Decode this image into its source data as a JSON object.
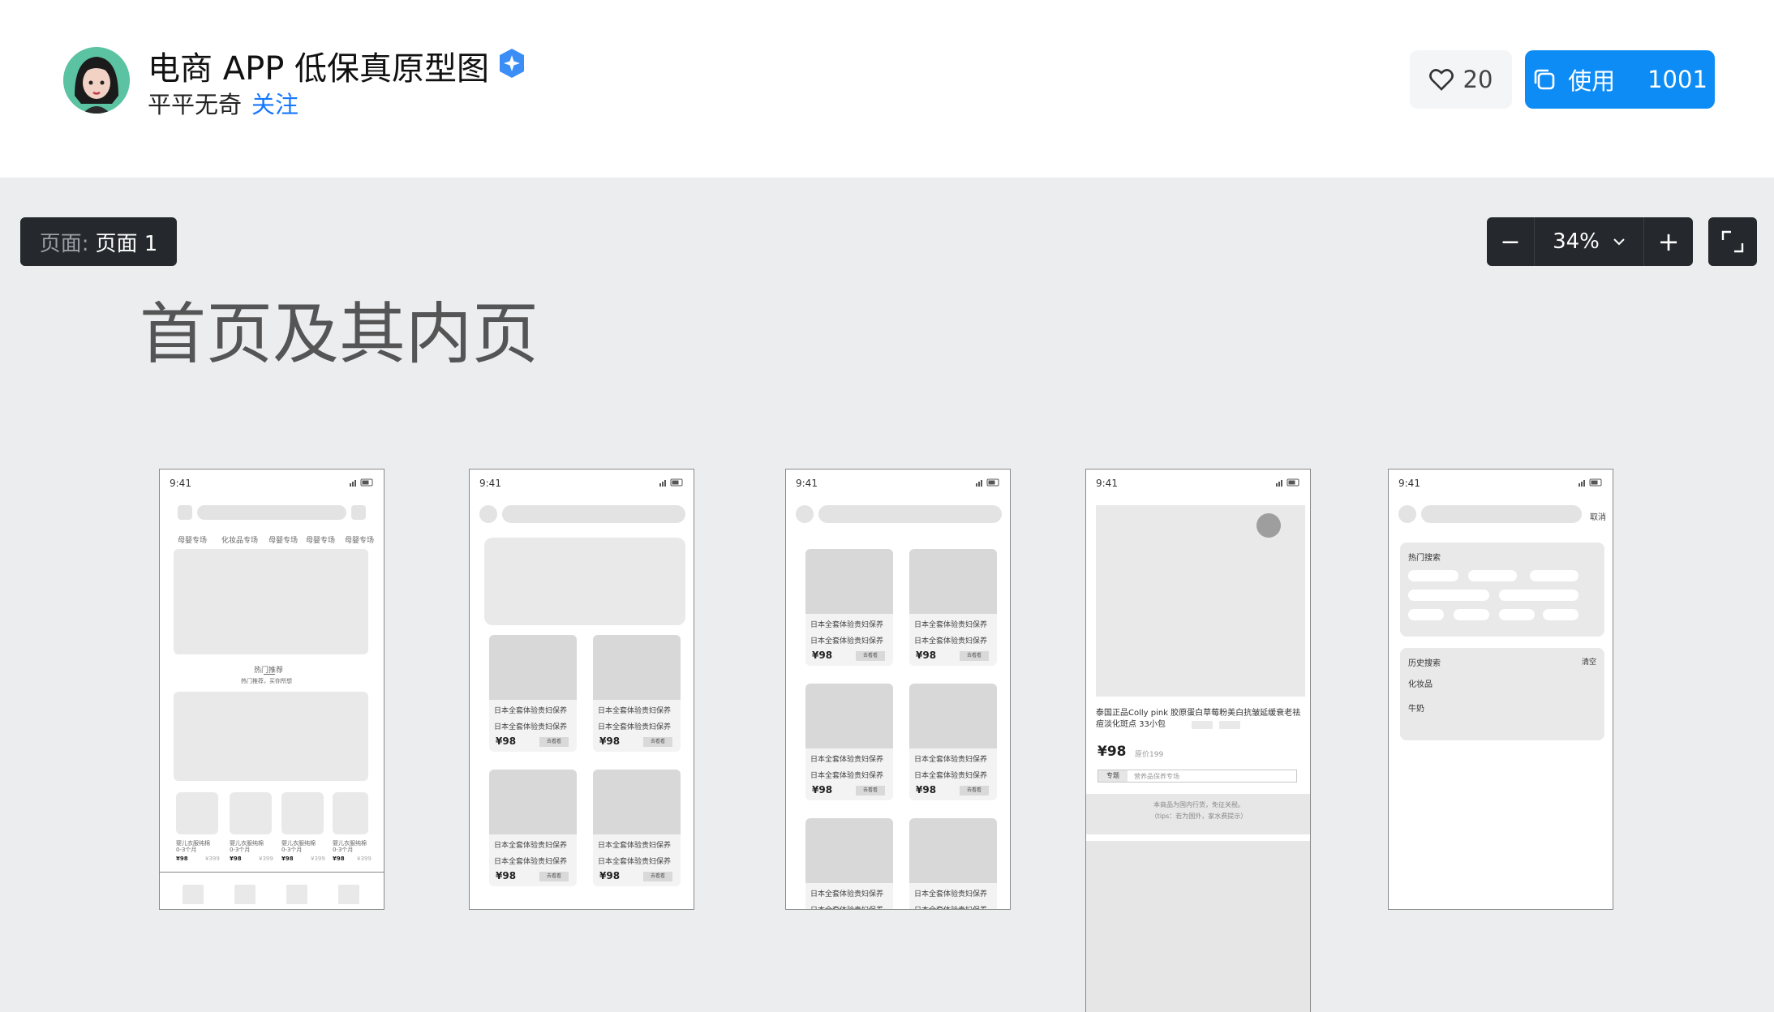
{
  "header": {
    "title": "电商 APP 低保真原型图",
    "author": "平平无奇",
    "follow_label": "关注",
    "like_count": "20",
    "use_label": "使用",
    "use_count": "1001",
    "colors": {
      "accent": "#0e8cf5",
      "link": "#1677ff"
    }
  },
  "toolbar": {
    "page_label": "页面:",
    "page_name": "页面 1",
    "zoom_level": "34%",
    "zoom_out": "−",
    "zoom_in": "+"
  },
  "canvas": {
    "title": "首页及其内页",
    "status_time": "9:41",
    "phone1": {
      "tabs": [
        "母婴专场",
        "化妆品专场",
        "母婴专场",
        "母婴专场",
        "母婴专场"
      ],
      "section_title": "热门推荐",
      "section_sub": "热门推荐，买你所想",
      "products": [
        {
          "name": "婴儿衣服纯棉",
          "sub": "0-3个月",
          "price": "¥98",
          "old": "¥399"
        },
        {
          "name": "婴儿衣服纯棉",
          "sub": "0-3个月",
          "price": "¥98",
          "old": "¥399"
        },
        {
          "name": "婴儿衣服纯棉",
          "sub": "0-3个月",
          "price": "¥98",
          "old": "¥399"
        },
        {
          "name": "婴儿衣服纯棉",
          "sub": "0-3个月",
          "price": "¥98",
          "old": "¥399"
        }
      ]
    },
    "card": {
      "line1": "日本全套体验贵妇保养",
      "line2": "日本全套体验贵妇保养",
      "price": "¥98",
      "button": "去看看"
    },
    "phone4": {
      "product_title": "泰国正品Colly pink 胶原蛋白草莓粉美白抗皱延缓衰老祛痘淡化斑点 33小包",
      "price": "¥98",
      "original_price": "原价199",
      "tag": "专题",
      "tag_text": "营养品保养专场",
      "notice1": "本商品为国内行货，免征关税。",
      "notice2": "（tips：若为国外，家水费提示）"
    },
    "phone5": {
      "cancel": "取消",
      "hot_title": "热门搜索",
      "history_title": "历史搜索",
      "clear": "清空",
      "history": [
        "化妆品",
        "牛奶"
      ]
    }
  }
}
